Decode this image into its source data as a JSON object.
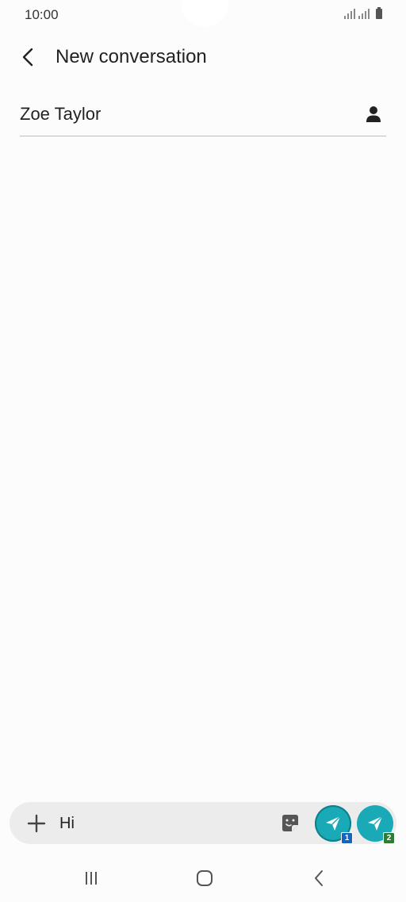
{
  "status_bar": {
    "time": "10:00"
  },
  "header": {
    "title": "New conversation"
  },
  "recipient": {
    "value": "Zoe Taylor"
  },
  "composer": {
    "message_value": "Hi",
    "sim1_badge": "1",
    "sim2_badge": "2",
    "sim1_color": "#1565c0",
    "sim2_color": "#2e7d32",
    "send_color": "#1aa9b7"
  },
  "icons": {
    "back": "chevron-left-icon",
    "contact": "person-icon",
    "attach": "plus-icon",
    "sticker": "sticker-icon",
    "send": "send-icon"
  }
}
